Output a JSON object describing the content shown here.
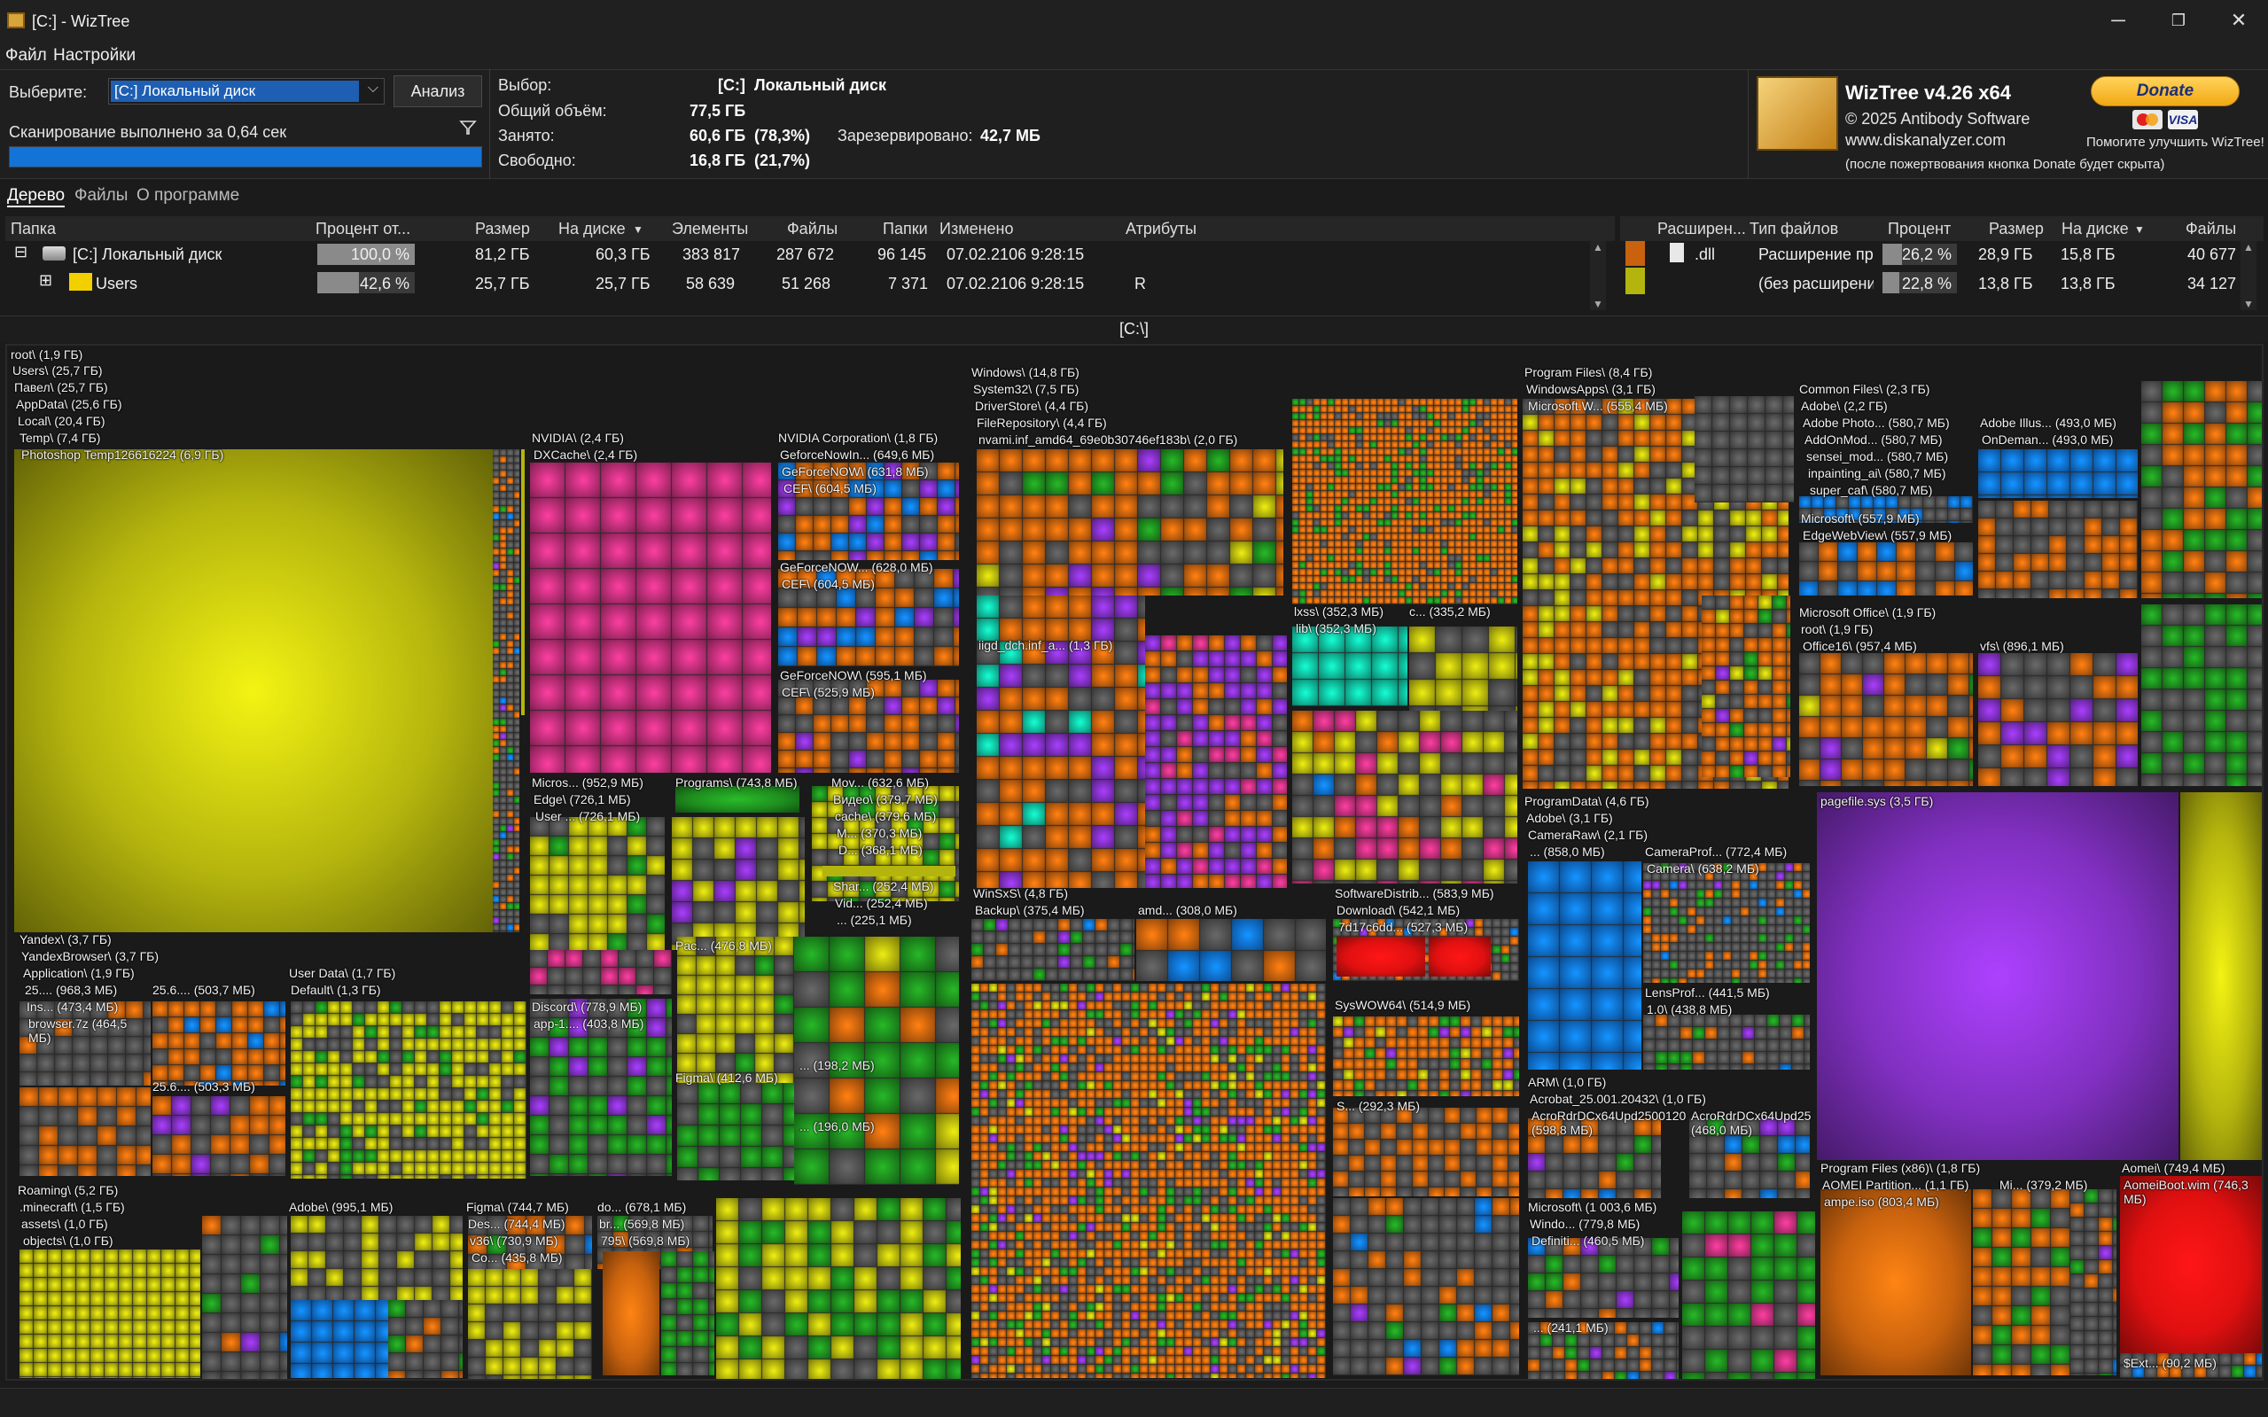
{
  "window": {
    "title": "[C:]  - WizTree",
    "minimize": "─",
    "maximize": "❐",
    "close": "✕"
  },
  "menu": {
    "file": "Файл",
    "settings": "Настройки"
  },
  "scan": {
    "select_label": "Выберите:",
    "drive_value": "[C:] Локальный диск",
    "analyze_label": "Анализ",
    "status": "Сканирование выполнено за 0,64 сек",
    "progress": 1.0
  },
  "selection": {
    "label": "Выбор:",
    "drive": "[C:]",
    "drive_name": "Локальный диск",
    "total_label": "Общий объём:",
    "total": "77,5 ГБ",
    "used_label": "Занято:",
    "used": "60,6 ГБ",
    "used_pct": "(78,3%)",
    "reserved_label": "Зарезервировано:",
    "reserved": "42,7 МБ",
    "free_label": "Свободно:",
    "free": "16,8 ГБ",
    "free_pct": "(21,7%)"
  },
  "about": {
    "name": "WizTree v4.26 x64",
    "copyright": "© 2025 Antibody Software",
    "site": "www.diskanalyzer.com",
    "note": "(после пожертвования кнопка Donate будет скрыта)",
    "donate": "Donate",
    "help": "Помогите улучшить WizTree!",
    "visa": "VISA"
  },
  "tabs": {
    "tree": "Дерево",
    "files": "Файлы",
    "about": "О программе"
  },
  "tree_header": {
    "folder": "Папка",
    "percent": "Процент от...",
    "size": "Размер",
    "on_disk": "На диске",
    "items": "Элементы",
    "files": "Файлы",
    "folders": "Папки",
    "modified": "Изменено",
    "attributes": "Атрибуты"
  },
  "tree_rows": [
    {
      "expander": "⊟",
      "name": "[C:] Локальный диск",
      "percent": "100,0 %",
      "pct_value": 1.0,
      "size": "81,2 ГБ",
      "on_disk": "60,3 ГБ",
      "items": "383 817",
      "files": "287 672",
      "folders": "96 145",
      "modified": "07.02.2106 9:28:15",
      "attributes": ""
    },
    {
      "expander": "⊞",
      "name": "Users",
      "percent": "42,6 %",
      "pct_value": 0.426,
      "size": "25,7 ГБ",
      "on_disk": "25,7 ГБ",
      "items": "58 639",
      "files": "51 268",
      "folders": "7 371",
      "modified": "07.02.2106 9:28:15",
      "attributes": "R"
    }
  ],
  "ext_header": {
    "ext": "Расширен...",
    "type": "Тип файлов",
    "percent": "Процент",
    "size": "Размер",
    "on_disk": "На диске",
    "files": "Файлы"
  },
  "ext_rows": [
    {
      "color": "#c8620e",
      "ext": ".dll",
      "type": "Расширение при",
      "percent": "26,2 %",
      "pct_value": 0.262,
      "size": "28,9 ГБ",
      "on_disk": "15,8 ГБ",
      "files": "40 677"
    },
    {
      "color": "#b4b40e",
      "ext": "",
      "type": "(без расширени",
      "percent": "22,8 %",
      "pct_value": 0.228,
      "size": "13,8 ГБ",
      "on_disk": "13,8 ГБ",
      "files": "34 127"
    }
  ],
  "path": "[C:\\]",
  "tm": {
    "root": "root\\ (1,9 ГБ)",
    "users": "Users\\ (25,7 ГБ)",
    "pavel": "Павел\\ (25,7 ГБ)",
    "appdata": "AppData\\ (25,6 ГБ)",
    "local": "Local\\ (20,4 ГБ)",
    "temp": "Temp\\ (7,4 ГБ)",
    "ps": "Photoshop Temp126616224 (6,9 ГБ)",
    "nvidia": "NVIDIA\\ (2,4 ГБ)",
    "dxcache": "DXCache\\ (2,4 ГБ)",
    "nvcorp": "NVIDIA Corporation\\ (1,8 ГБ)",
    "gfn1": "GeforceNowIn... (649,6 МБ)",
    "gfn2": "GeForceNOW\\ (631,8 МБ)",
    "cef1": "CEF\\ (604,5 МБ)",
    "gfn3": "GeForceNOW... (628,0 МБ)",
    "cef2": "CEF\\ (604,5 МБ)",
    "gfn4": "GeForceNOW\\ (595,1 МБ)",
    "cef3": "CEF\\ (525,9 МБ)",
    "micros": "Micros... (952,9 МБ)",
    "edge": "Edge\\ (726,1 МБ)",
    "user1": "User ... (726,1 МБ)",
    "programs": "Programs\\ (743,8 МБ)",
    "mov": "Mov... (632,6 МБ)",
    "video": "Видео\\ (379,7 МБ)",
    "cache": "cache\\ (379,6 МБ)",
    "m1": "M... (370,3 МБ)",
    "d1": "D... (368,1 МБ)",
    "shar": "Shar... (252,4 МБ)",
    "vid": "Vid... (252,4 МБ)",
    "dots225": "... (225,1 МБ)",
    "pac": "Pac... (476,8 МБ)",
    "d198": "... (198,2 МБ)",
    "figma1": "Figma\\ (412,6 МБ)",
    "d196": "... (196,0 МБ)",
    "discord": "Discord\\ (778,9 МБ)",
    "app1": "app-1.... (403,8 МБ)",
    "yandex": "Yandex\\ (3,7 ГБ)",
    "ybrowser": "YandexBrowser\\ (3,7 ГБ)",
    "application": "Application\\ (1,9 ГБ)",
    "y25a": "25.... (968,3 МБ)",
    "y25b": "25.6.... (503,7 МБ)",
    "ins": "Ins... (473,4 МБ)",
    "browser7z": "browser.7z (464,5 МБ)",
    "y25c": "25.6.... (503,3 МБ)",
    "userdata": "User Data\\ (1,7 ГБ)",
    "default": "Default\\ (1,3 ГБ)",
    "roaming": "Roaming\\ (5,2 ГБ)",
    "minecraft": ".minecraft\\ (1,5 ГБ)",
    "assets": "assets\\ (1,0 ГБ)",
    "objects": "objects\\ (1,0 ГБ)",
    "adobe1": "Adobe\\ (995,1 МБ)",
    "figma2": "Figma\\ (744,7 МБ)",
    "des": "Des... (744,4 МБ)",
    "v36": "v36\\ (730,9 МБ)",
    "co": "Co... (435,8 МБ)",
    "do678": "do... (678,1 МБ)",
    "br": "br... (569,8 МБ)",
    "v795": "795\\ (569,8 МБ)",
    "windows": "Windows\\ (14,8 ГБ)",
    "system32": "System32\\ (7,5 ГБ)",
    "driverstore": "DriverStore\\ (4,4 ГБ)",
    "filerepo": "FileRepository\\ (4,4 ГБ)",
    "nvami": "nvami.inf_amd64_69e0b30746ef183b\\ (2,0 ГБ)",
    "iigd": "iigd_dch.inf_a... (1,3 ГБ)",
    "lxss": "lxss\\ (352,3 МБ)",
    "lib": "lib\\ (352,3 МБ)",
    "c335": "c... (335,2 МБ)",
    "winsxs": "WinSxS\\ (4,8 ГБ)",
    "backup": "Backup\\ (375,4 МБ)",
    "amd": "amd... (308,0 МБ)",
    "swdist": "SoftwareDistrib... (583,9 МБ)",
    "download": "Download\\ (542,1 МБ)",
    "d7": "7d17c6dd... (527,3 МБ)",
    "syswow": "SysWOW64\\ (514,9 МБ)",
    "s292": "S... (292,3 МБ)",
    "progfiles": "Program Files\\ (8,4 ГБ)",
    "winapps": "WindowsApps\\ (3,1 ГБ)",
    "msw": "Microsoft.W... (555,4 МБ)",
    "common": "Common Files\\ (2,3 ГБ)",
    "adobe2": "Adobe\\ (2,2 ГБ)",
    "adobephoto": "Adobe Photo... (580,7 МБ)",
    "addon": "AddOnMod... (580,7 МБ)",
    "sensei": "sensei_mod... (580,7 МБ)",
    "inpaint": "inpainting_ai\\ (580,7 МБ)",
    "supercaf": "super_caf\\ (580,7 МБ)",
    "adobeillus": "Adobe Illus... (493,0 МБ)",
    "ondemand": "OnDeman... (493,0 МБ)",
    "ms557": "Microsoft\\ (557,9 МБ)",
    "edgewv": "EdgeWebView\\ (557,9 МБ)",
    "msoffice": "Microsoft Office\\ (1,9 ГБ)",
    "office16": "Office16\\ (957,4 МБ)",
    "vfs": "vfs\\ (896,1 МБ)",
    "progdata": "ProgramData\\ (4,6 ГБ)",
    "adobe3": "Adobe\\ (3,1 ГБ)",
    "cameraraw": "CameraRaw\\ (2,1 ГБ)",
    "d858": "... (858,0 МБ)",
    "cameraprof": "CameraProf... (772,4 МБ)",
    "camera": "Camera\\ (638,2 МБ)",
    "lensprof": "LensProf... (441,5 МБ)",
    "lens10": "1.0\\ (438,8 МБ)",
    "arm": "ARM\\ (1,0 ГБ)",
    "acrobat": "Acrobat_25.001.20432\\ (1,0 ГБ)",
    "acro1": "AcroRdrDCx64Upd2500120 (598,8 МБ)",
    "acro2": "AcroRdrDCx64Upd25 (468,0 МБ)",
    "ms1003": "Microsoft\\ (1 003,6 МБ)",
    "windo": "Windo... (779,8 МБ)",
    "defin": "Definiti... (460,5 МБ)",
    "d241": "... (241,1 МБ)",
    "pagefile": "pagefile.sys (3,5 ГБ)",
    "pfx86": "Program Files (x86)\\ (1,8 ГБ)",
    "aomeipart": "AOMEI Partition... (1,1 ГБ)",
    "ampe": "ampe.iso (803,4 МБ)",
    "mi379": "Mi... (379,2 МБ)",
    "aomei": "Aomei\\ (749,4 МБ)",
    "aomeiboot": "AomeiBoot.wim (746,3 МБ)",
    "ext902": "$Ext... (90,2 МБ)"
  },
  "colors": {
    "orange": "#c8620e",
    "yellow": "#b4b40e",
    "green": "#1e8c1e",
    "magenta": "#c0307a",
    "purple": "#8030c0",
    "blue": "#1070e0",
    "gray": "#505050",
    "red": "#e01010",
    "cyan": "#10c0a0"
  }
}
